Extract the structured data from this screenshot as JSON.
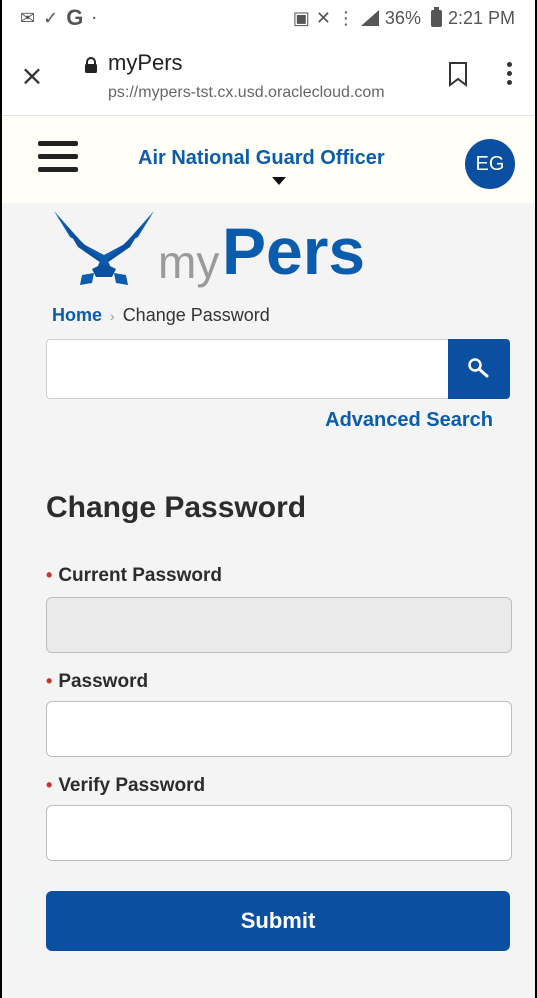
{
  "status_bar": {
    "time": "2:21 PM",
    "battery_percent": "36%",
    "icons": [
      "message-icon",
      "check-icon",
      "google-icon",
      "dot-icon",
      "lock-screen-icon",
      "mute-icon",
      "wifi-calling-icon",
      "signal-icon",
      "battery-icon"
    ]
  },
  "browser": {
    "page_title": "myPers",
    "url": "ps://mypers-tst.cx.usd.oraclecloud.com",
    "icons": [
      "close-icon",
      "lock-icon",
      "bookmark-icon",
      "more-options-icon"
    ]
  },
  "header": {
    "role": "Air National Guard Officer",
    "avatar_initials": "EG",
    "icons": [
      "hamburger-menu-icon",
      "caret-down-icon"
    ]
  },
  "logo": {
    "word_my": "my",
    "word_pers": "Pers",
    "colors": {
      "my": "#9a9a9a",
      "pers": "#0b5cad"
    }
  },
  "breadcrumb": {
    "home": "Home",
    "separator": "›",
    "current": "Change Password"
  },
  "search": {
    "value": "",
    "placeholder": "",
    "advanced_link": "Advanced Search",
    "icon": "search-icon"
  },
  "form": {
    "heading": "Change Password",
    "fields": [
      {
        "label": "Current Password",
        "required": true,
        "value": ""
      },
      {
        "label": "Password",
        "required": true,
        "value": ""
      },
      {
        "label": "Verify Password",
        "required": true,
        "value": ""
      }
    ],
    "required_marker": "•",
    "submit_label": "Submit"
  },
  "colors": {
    "brand_blue": "#0b4fa0",
    "link_blue": "#0b5cad",
    "required_red": "#c0392b"
  }
}
